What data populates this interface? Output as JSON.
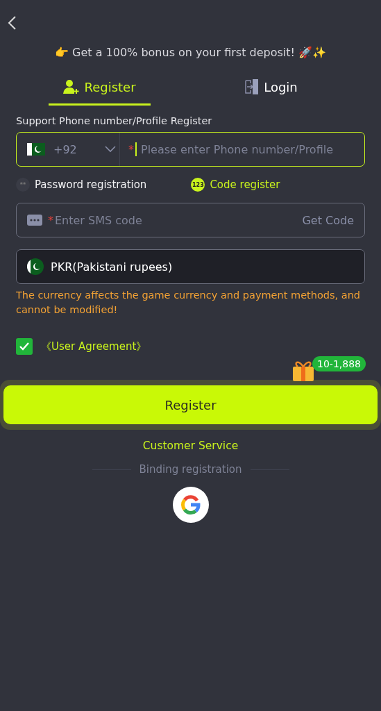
{
  "banner": "👉 Get a 100% bonus on your first deposit! 🚀✨",
  "tabs": [
    {
      "label": "Register",
      "selected": true
    },
    {
      "label": "Login",
      "selected": false
    }
  ],
  "phone": {
    "label": "Support Phone number/Profile Register",
    "country_code": "+92",
    "required_mark": "*",
    "placeholder": "Please enter Phone number/Profile",
    "focused": true
  },
  "modes": [
    {
      "label": "Password registration",
      "icon": "**",
      "selected": false
    },
    {
      "label": "Code register",
      "icon": "123",
      "selected": true
    }
  ],
  "sms": {
    "required_mark": "*",
    "placeholder": "Enter SMS code",
    "action": "Get Code"
  },
  "currency": {
    "value": "PKR(Pakistani rupees)",
    "warning": "The currency affects the game currency and payment methods, and cannot be modified!"
  },
  "agreement": {
    "label": "《User Agreement》",
    "checked": true
  },
  "bonus_badge": "10-1,888",
  "register_button": "Register",
  "customer_service": "Customer Service",
  "binding_label": "Binding registration"
}
